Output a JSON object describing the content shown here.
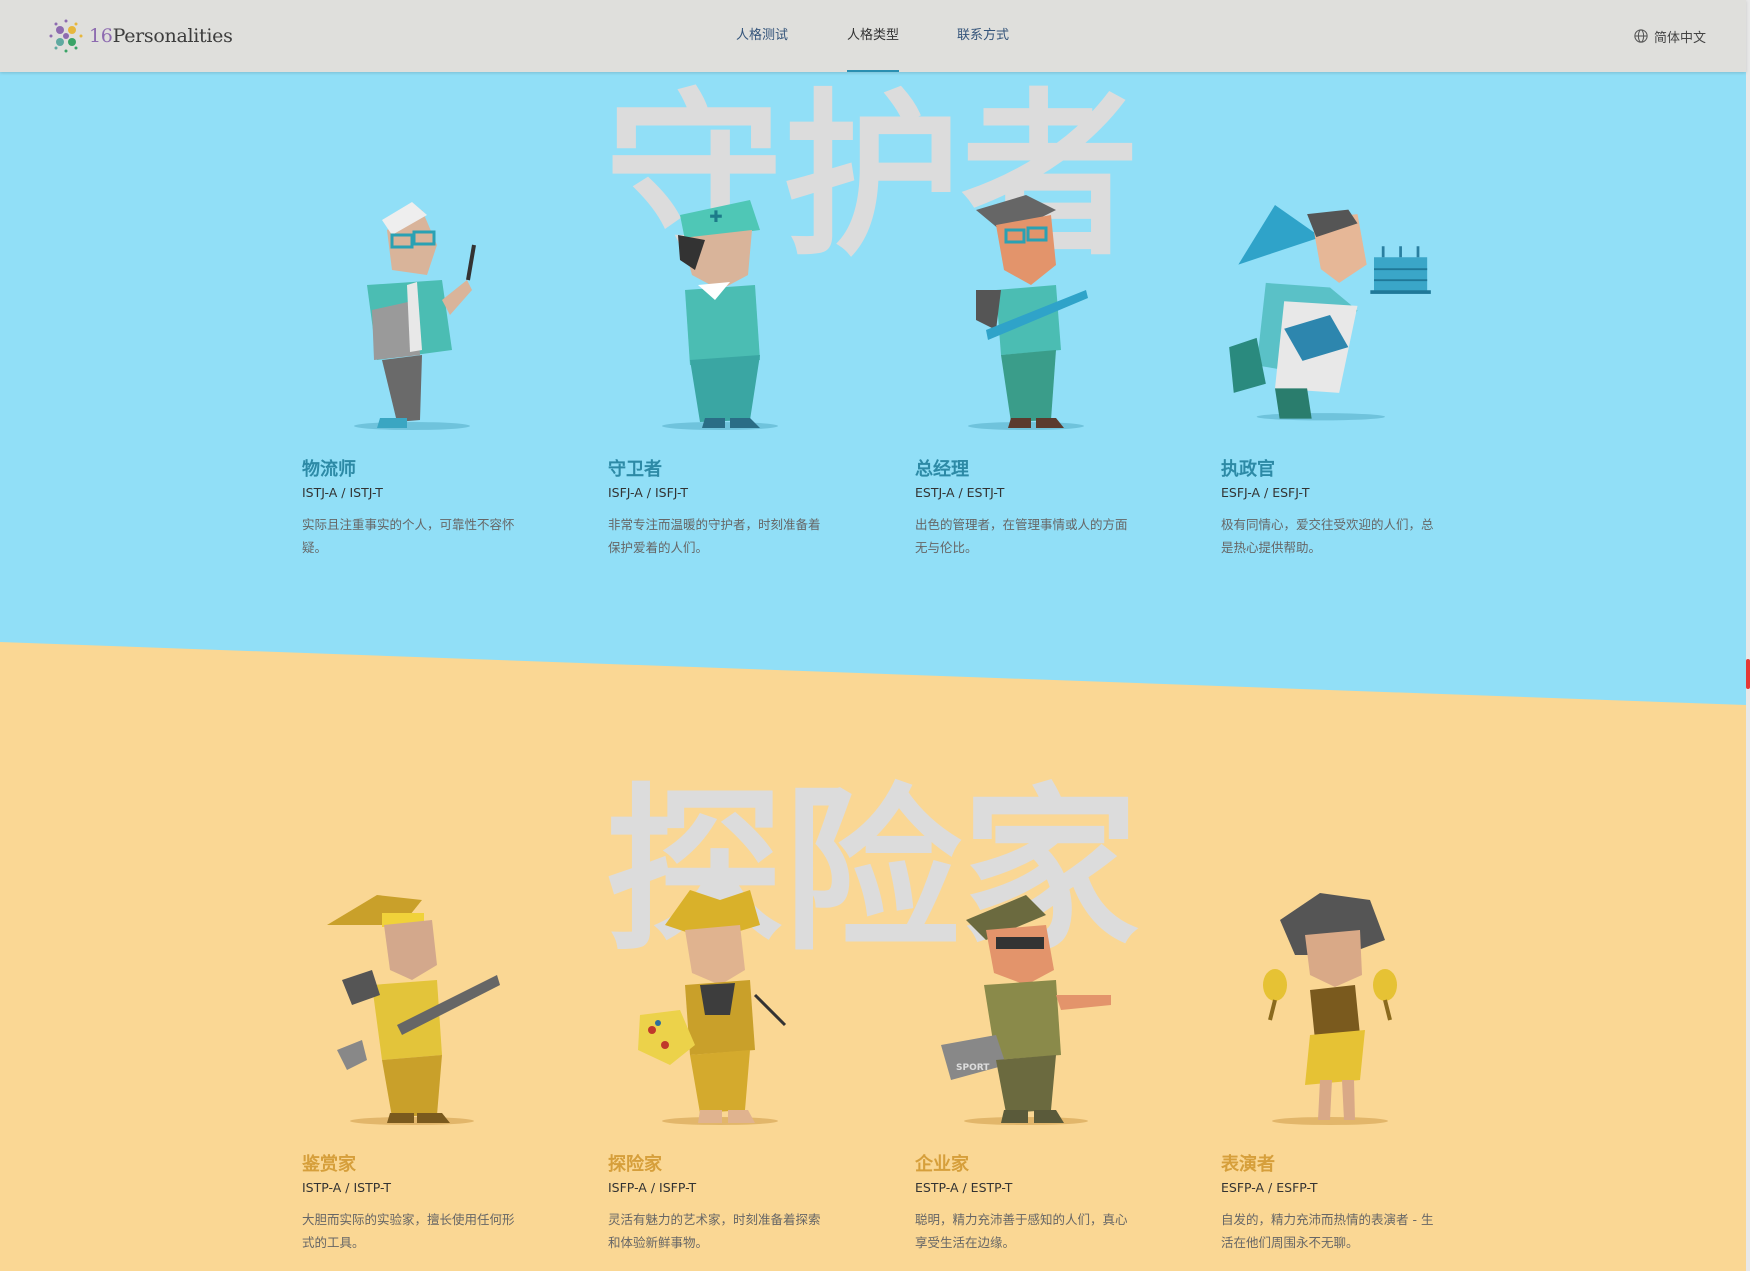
{
  "header": {
    "logo_number": "16",
    "logo_text": "Personalities",
    "nav": [
      "人格测试",
      "人格类型",
      "联系方式"
    ],
    "active_nav": "人格类型",
    "language": "简体中文"
  },
  "sentinels": {
    "title": "守护者",
    "cards": [
      {
        "name": "物流师",
        "code": "ISTJ-A / ISTJ-T",
        "desc": "实际且注重事实的个人，可靠性不容怀疑。"
      },
      {
        "name": "守卫者",
        "code": "ISFJ-A / ISFJ-T",
        "desc": "非常专注而温暖的守护者，时刻准备着保护爱着的人们。"
      },
      {
        "name": "总经理",
        "code": "ESTJ-A / ESTJ-T",
        "desc": "出色的管理者，在管理事情或人的方面无与伦比。"
      },
      {
        "name": "执政官",
        "code": "ESFJ-A / ESFJ-T",
        "desc": "极有同情心，爱交往受欢迎的人们，总是热心提供帮助。"
      }
    ]
  },
  "explorers": {
    "title": "探险家",
    "cards": [
      {
        "name": "鉴赏家",
        "code": "ISTP-A / ISTP-T",
        "desc": "大胆而实际的实验家，擅长使用任何形式的工具。"
      },
      {
        "name": "探险家",
        "code": "ISFP-A / ISFP-T",
        "desc": "灵活有魅力的艺术家，时刻准备着探索和体验新鲜事物。"
      },
      {
        "name": "企业家",
        "code": "ESTP-A / ESTP-T",
        "desc": "聪明，精力充沛善于感知的人们，真心享受生活在边缘。"
      },
      {
        "name": "表演者",
        "code": "ESFP-A / ESFP-T",
        "desc": "自发的，精力充沛而热情的表演者 - 生活在他们周围永不无聊。"
      }
    ],
    "figure_labels": [
      "SPORT"
    ]
  },
  "colors": {
    "sentinel_bg": "#91dff7",
    "explorer_bg": "#fad794",
    "sentinel_accent": "#2d8aa6",
    "explorer_accent": "#d69f3b"
  }
}
